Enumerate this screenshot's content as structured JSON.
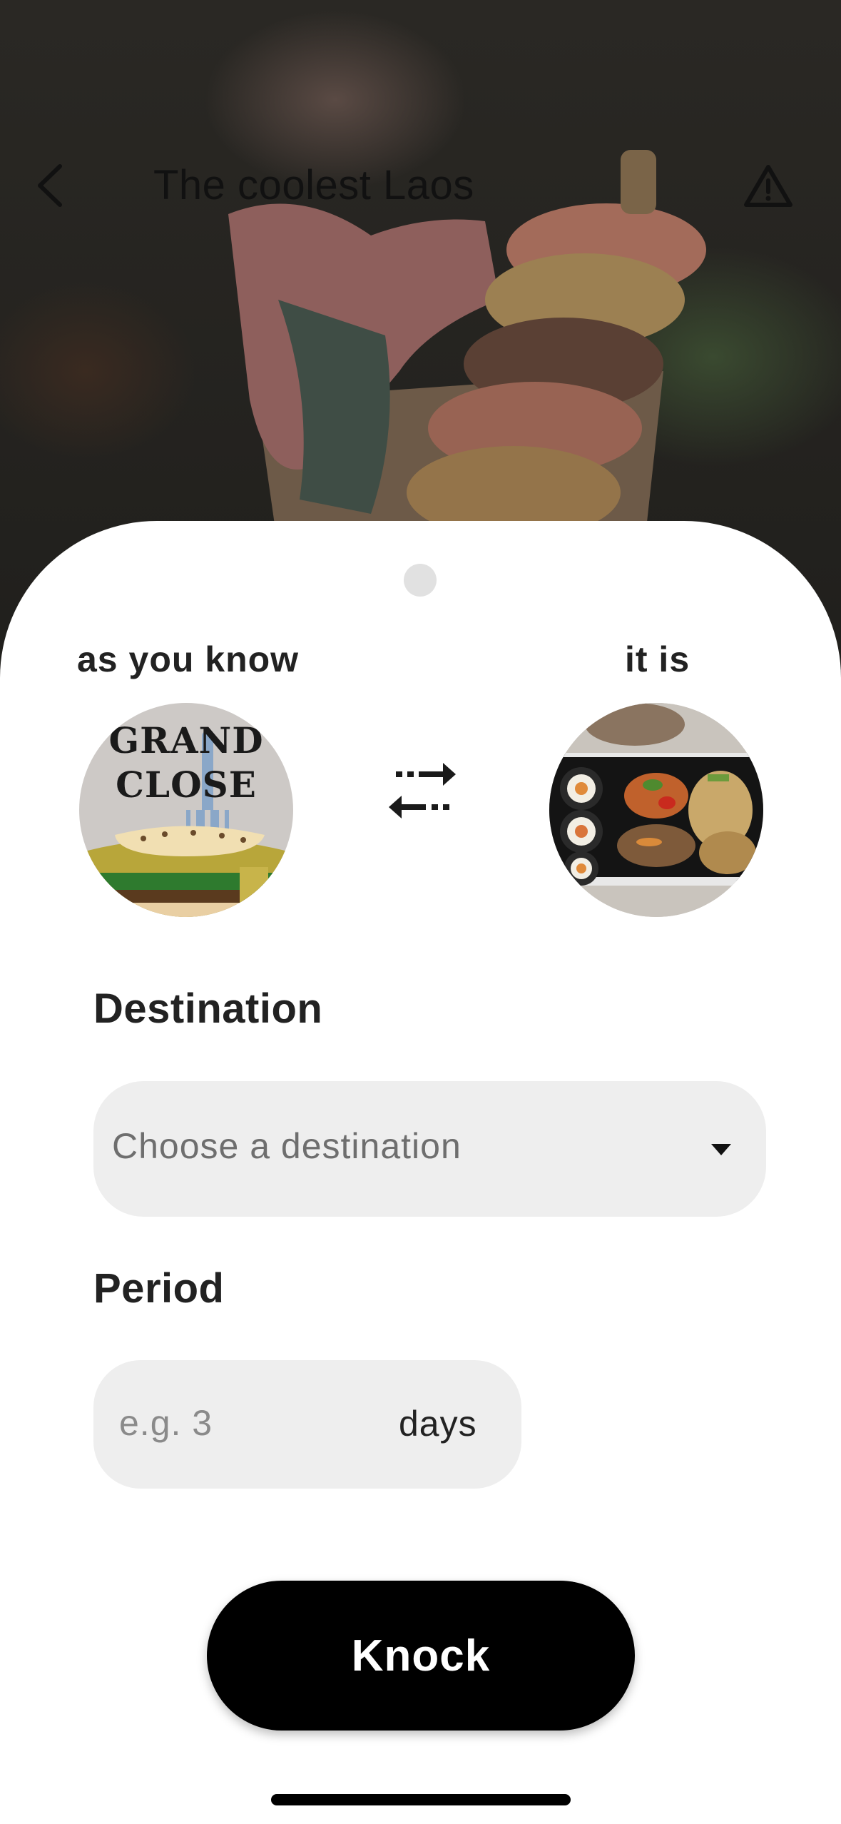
{
  "header": {
    "title": "The coolest Laos",
    "back_icon": "chevron-left-icon",
    "report_icon": "warning-triangle-icon"
  },
  "swap": {
    "from_label": "as you know",
    "to_label": "it is",
    "from_avatar_text_line1": "GRAND",
    "from_avatar_text_line2": "CLOSE",
    "swap_icon": "swap-arrows-icon"
  },
  "destination": {
    "label": "Destination",
    "placeholder": "Choose a destination",
    "dropdown_icon": "caret-down-icon"
  },
  "period": {
    "label": "Period",
    "placeholder": "e.g. 3",
    "unit": "days"
  },
  "actions": {
    "knock_label": "Knock"
  },
  "colors": {
    "sheet_background": "#ffffff",
    "field_background": "#eeeeee",
    "primary_button": "#000000",
    "primary_button_text": "#ffffff"
  }
}
